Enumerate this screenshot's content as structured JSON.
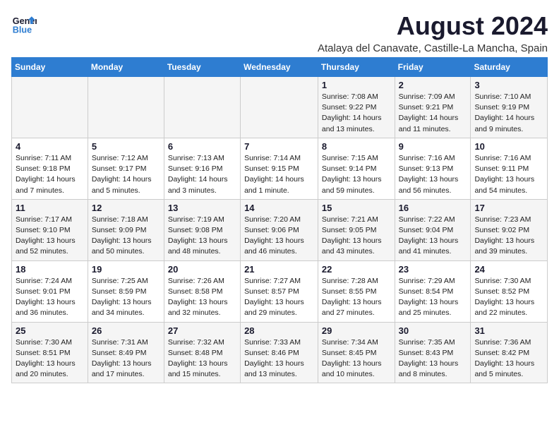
{
  "header": {
    "logo_general": "General",
    "logo_blue": "Blue",
    "month_year": "August 2024",
    "location": "Atalaya del Canavate, Castille-La Mancha, Spain"
  },
  "days_of_week": [
    "Sunday",
    "Monday",
    "Tuesday",
    "Wednesday",
    "Thursday",
    "Friday",
    "Saturday"
  ],
  "weeks": [
    [
      {
        "day": "",
        "info": ""
      },
      {
        "day": "",
        "info": ""
      },
      {
        "day": "",
        "info": ""
      },
      {
        "day": "",
        "info": ""
      },
      {
        "day": "1",
        "info": "Sunrise: 7:08 AM\nSunset: 9:22 PM\nDaylight: 14 hours\nand 13 minutes."
      },
      {
        "day": "2",
        "info": "Sunrise: 7:09 AM\nSunset: 9:21 PM\nDaylight: 14 hours\nand 11 minutes."
      },
      {
        "day": "3",
        "info": "Sunrise: 7:10 AM\nSunset: 9:19 PM\nDaylight: 14 hours\nand 9 minutes."
      }
    ],
    [
      {
        "day": "4",
        "info": "Sunrise: 7:11 AM\nSunset: 9:18 PM\nDaylight: 14 hours\nand 7 minutes."
      },
      {
        "day": "5",
        "info": "Sunrise: 7:12 AM\nSunset: 9:17 PM\nDaylight: 14 hours\nand 5 minutes."
      },
      {
        "day": "6",
        "info": "Sunrise: 7:13 AM\nSunset: 9:16 PM\nDaylight: 14 hours\nand 3 minutes."
      },
      {
        "day": "7",
        "info": "Sunrise: 7:14 AM\nSunset: 9:15 PM\nDaylight: 14 hours\nand 1 minute."
      },
      {
        "day": "8",
        "info": "Sunrise: 7:15 AM\nSunset: 9:14 PM\nDaylight: 13 hours\nand 59 minutes."
      },
      {
        "day": "9",
        "info": "Sunrise: 7:16 AM\nSunset: 9:13 PM\nDaylight: 13 hours\nand 56 minutes."
      },
      {
        "day": "10",
        "info": "Sunrise: 7:16 AM\nSunset: 9:11 PM\nDaylight: 13 hours\nand 54 minutes."
      }
    ],
    [
      {
        "day": "11",
        "info": "Sunrise: 7:17 AM\nSunset: 9:10 PM\nDaylight: 13 hours\nand 52 minutes."
      },
      {
        "day": "12",
        "info": "Sunrise: 7:18 AM\nSunset: 9:09 PM\nDaylight: 13 hours\nand 50 minutes."
      },
      {
        "day": "13",
        "info": "Sunrise: 7:19 AM\nSunset: 9:08 PM\nDaylight: 13 hours\nand 48 minutes."
      },
      {
        "day": "14",
        "info": "Sunrise: 7:20 AM\nSunset: 9:06 PM\nDaylight: 13 hours\nand 46 minutes."
      },
      {
        "day": "15",
        "info": "Sunrise: 7:21 AM\nSunset: 9:05 PM\nDaylight: 13 hours\nand 43 minutes."
      },
      {
        "day": "16",
        "info": "Sunrise: 7:22 AM\nSunset: 9:04 PM\nDaylight: 13 hours\nand 41 minutes."
      },
      {
        "day": "17",
        "info": "Sunrise: 7:23 AM\nSunset: 9:02 PM\nDaylight: 13 hours\nand 39 minutes."
      }
    ],
    [
      {
        "day": "18",
        "info": "Sunrise: 7:24 AM\nSunset: 9:01 PM\nDaylight: 13 hours\nand 36 minutes."
      },
      {
        "day": "19",
        "info": "Sunrise: 7:25 AM\nSunset: 8:59 PM\nDaylight: 13 hours\nand 34 minutes."
      },
      {
        "day": "20",
        "info": "Sunrise: 7:26 AM\nSunset: 8:58 PM\nDaylight: 13 hours\nand 32 minutes."
      },
      {
        "day": "21",
        "info": "Sunrise: 7:27 AM\nSunset: 8:57 PM\nDaylight: 13 hours\nand 29 minutes."
      },
      {
        "day": "22",
        "info": "Sunrise: 7:28 AM\nSunset: 8:55 PM\nDaylight: 13 hours\nand 27 minutes."
      },
      {
        "day": "23",
        "info": "Sunrise: 7:29 AM\nSunset: 8:54 PM\nDaylight: 13 hours\nand 25 minutes."
      },
      {
        "day": "24",
        "info": "Sunrise: 7:30 AM\nSunset: 8:52 PM\nDaylight: 13 hours\nand 22 minutes."
      }
    ],
    [
      {
        "day": "25",
        "info": "Sunrise: 7:30 AM\nSunset: 8:51 PM\nDaylight: 13 hours\nand 20 minutes."
      },
      {
        "day": "26",
        "info": "Sunrise: 7:31 AM\nSunset: 8:49 PM\nDaylight: 13 hours\nand 17 minutes."
      },
      {
        "day": "27",
        "info": "Sunrise: 7:32 AM\nSunset: 8:48 PM\nDaylight: 13 hours\nand 15 minutes."
      },
      {
        "day": "28",
        "info": "Sunrise: 7:33 AM\nSunset: 8:46 PM\nDaylight: 13 hours\nand 13 minutes."
      },
      {
        "day": "29",
        "info": "Sunrise: 7:34 AM\nSunset: 8:45 PM\nDaylight: 13 hours\nand 10 minutes."
      },
      {
        "day": "30",
        "info": "Sunrise: 7:35 AM\nSunset: 8:43 PM\nDaylight: 13 hours\nand 8 minutes."
      },
      {
        "day": "31",
        "info": "Sunrise: 7:36 AM\nSunset: 8:42 PM\nDaylight: 13 hours\nand 5 minutes."
      }
    ]
  ]
}
